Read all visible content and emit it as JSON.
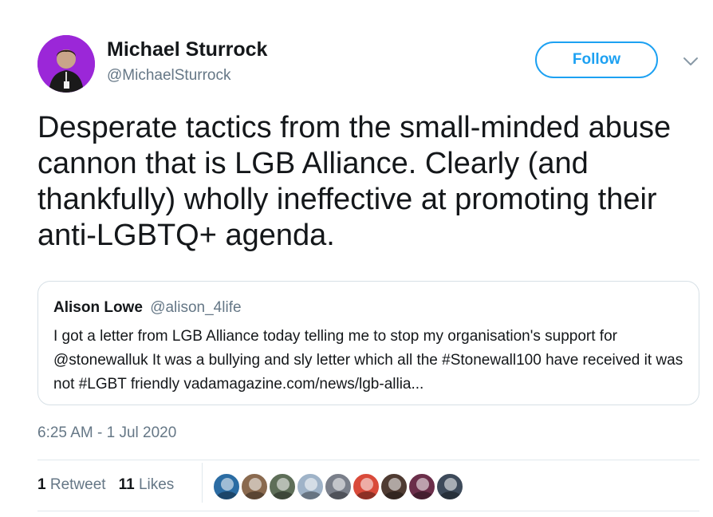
{
  "author": {
    "name": "Michael Sturrock",
    "handle": "@MichaelSturrock",
    "avatar_bg": "#9b27d8"
  },
  "follow_button": {
    "label": "Follow",
    "color": "#1da1f2"
  },
  "menu_icon": "chevron-down-icon",
  "tweet": {
    "text": "Desperate tactics from the small-minded abuse cannon that is LGB Alliance. Clearly (and thankfully) wholly ineffective at promoting their anti-LGBTQ+ agenda."
  },
  "quoted_tweet": {
    "name": "Alison Lowe",
    "handle": "@alison_4life",
    "text": "I got a letter from LGB Alliance today telling me to stop my organisation's support for @stonewalluk It was a bullying and sly letter which all the #Stonewall100 have received it was not #LGBT friendly vadamagazine.com/news/lgb-allia..."
  },
  "timestamp": "6:25 AM - 1 Jul 2020",
  "stats": {
    "retweets_count": "1",
    "retweets_label": "Retweet",
    "likes_count": "11",
    "likes_label": "Likes"
  },
  "likers": [
    {
      "color": "#2b6ca3"
    },
    {
      "color": "#8a6a4f"
    },
    {
      "color": "#5e6e58"
    },
    {
      "color": "#9fb3c8"
    },
    {
      "color": "#7a7f8a"
    },
    {
      "color": "#d94a3a"
    },
    {
      "color": "#4f3b32"
    },
    {
      "color": "#6b2e4a"
    },
    {
      "color": "#3d4a5a"
    }
  ]
}
